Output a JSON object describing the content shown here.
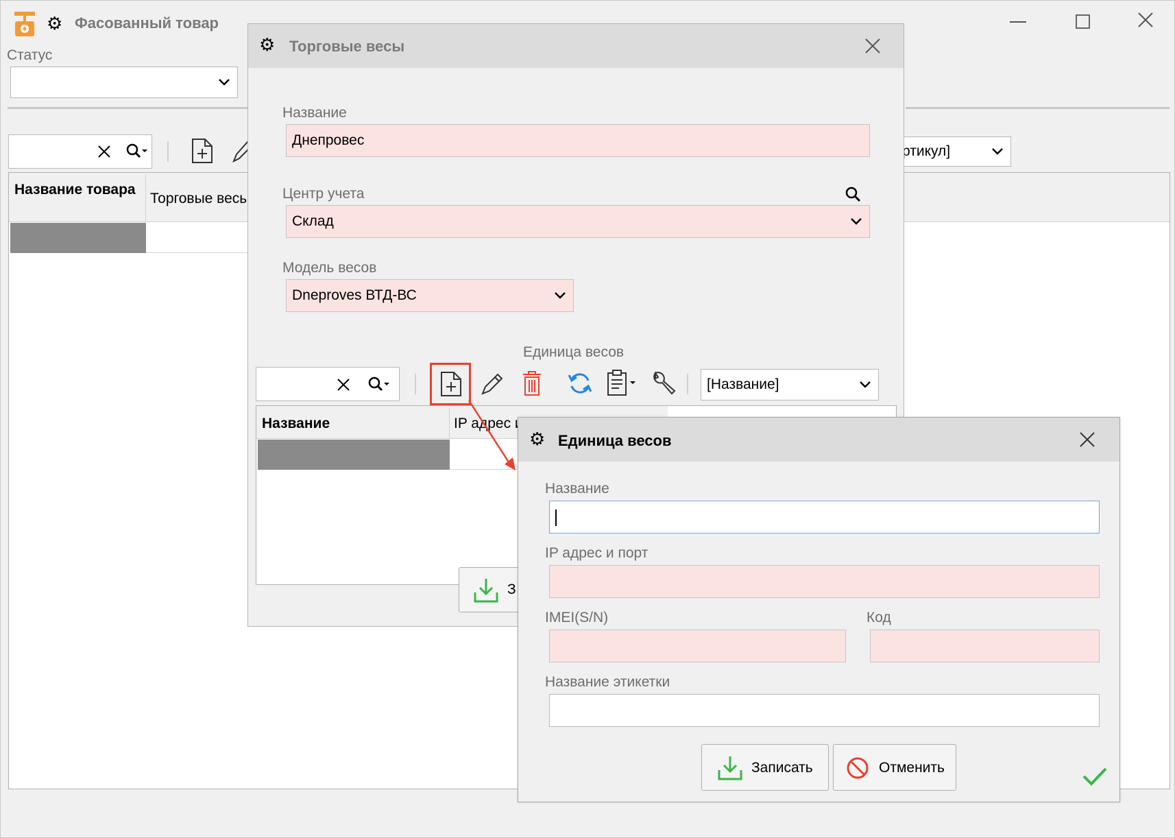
{
  "main_window": {
    "title": "Фасованный товар",
    "status_label": "Статус",
    "status_value": "",
    "search_value": "",
    "right_select_value": "ртикул]",
    "table": {
      "columns": [
        "Название товара",
        "Торговые весы"
      ]
    }
  },
  "scales_dialog": {
    "title": "Торговые весы",
    "name_label": "Название",
    "name_value": "Днепровес",
    "center_label": "Центр учета",
    "center_value": "Склад",
    "model_label": "Модель весов",
    "model_value": "Dneproves ВТД-ВС",
    "units_label": "Единица весов",
    "sort_select_value": "[Название]",
    "table": {
      "columns": [
        "Название",
        "IP адрес и"
      ]
    },
    "save_partial": "З"
  },
  "unit_dialog": {
    "title": "Единица весов",
    "name_label": "Название",
    "name_value": "",
    "ip_label": "IP адрес и порт",
    "ip_value": "",
    "imei_label": "IMEI(S/N)",
    "imei_value": "",
    "code_label": "Код",
    "code_value": "",
    "label_name_label": "Название этикетки",
    "label_name_value": "",
    "save_label": "Записать",
    "cancel_label": "Отменить"
  },
  "colors": {
    "required_field": "#fbe3e1",
    "accent_orange": "#f29a38",
    "highlight_red": "#e8412e",
    "green": "#3cb54a",
    "blue": "#1e88e5"
  }
}
